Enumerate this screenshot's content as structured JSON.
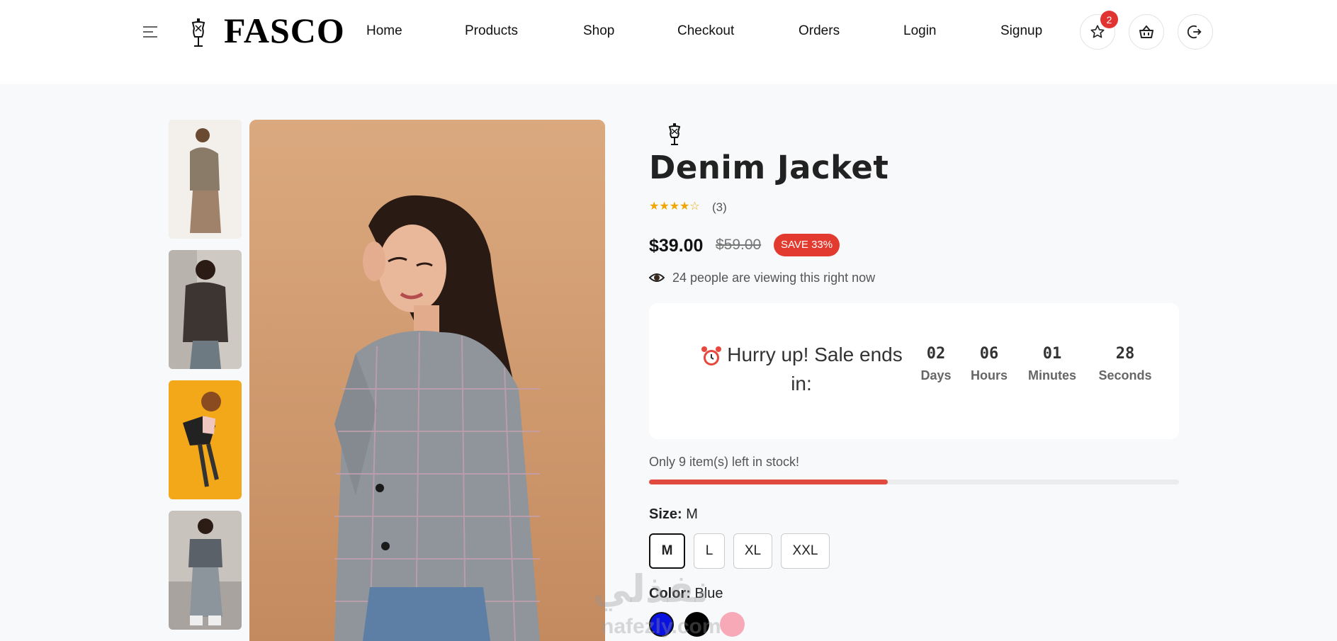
{
  "header": {
    "brand": "FASCO",
    "nav": [
      "Home",
      "Products",
      "Shop",
      "Checkout",
      "Orders",
      "Login",
      "Signup"
    ],
    "wishlist_count": "2"
  },
  "product": {
    "title": "Denim Jacket",
    "stars": "★★★★☆",
    "rating": 4,
    "review_count": "(3)",
    "price": "$39.00",
    "old_price": "$59.00",
    "save_label": "SAVE 33%",
    "viewing_text": "24 people are viewing this right now",
    "countdown": {
      "heading": "Hurry up! Sale ends in:",
      "units": [
        {
          "value": "02",
          "label": "Days"
        },
        {
          "value": "06",
          "label": "Hours"
        },
        {
          "value": "01",
          "label": "Minutes"
        },
        {
          "value": "28",
          "label": "Seconds"
        }
      ]
    },
    "stock_text": "Only 9 item(s) left in stock!",
    "stock_fraction": 0.45,
    "size_label": "Size:",
    "size_value": "M",
    "sizes": [
      "M",
      "L",
      "XL",
      "XXL"
    ],
    "color_label": "Color:",
    "color_value": "Blue",
    "colors": [
      "#0a12e0",
      "#000000",
      "#f7a9b8"
    ]
  },
  "watermark": {
    "text": "نفذلي",
    "subtext": "nafezly.com"
  },
  "icons": [
    "menu-icon",
    "mannequin-logo-icon",
    "star-icon",
    "basket-icon",
    "logout-icon",
    "eye-icon",
    "alarm-clock-icon"
  ],
  "colors": {
    "accent": "#e23a2f",
    "star": "#f0a500",
    "background": "#f8f9fa"
  }
}
